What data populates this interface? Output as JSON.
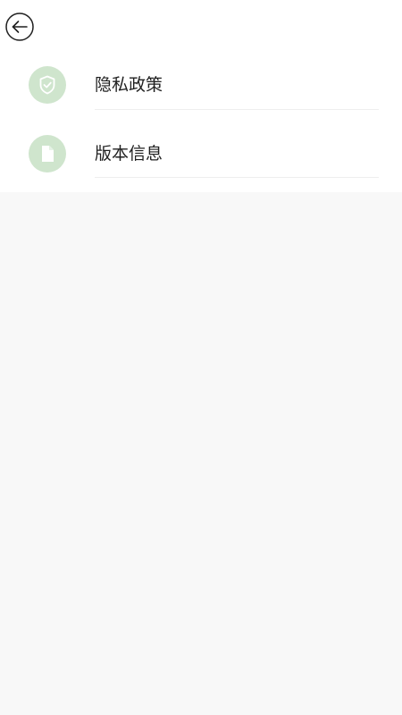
{
  "header": {
    "back_icon": "arrow-left-circle-icon"
  },
  "menu": {
    "items": [
      {
        "label": "隐私政策",
        "icon": "shield-check-icon"
      },
      {
        "label": "版本信息",
        "icon": "document-icon"
      }
    ]
  },
  "colors": {
    "icon_bg": "#cfe5cd",
    "icon_fg": "#ffffff",
    "page_bg": "#f8f8f8",
    "panel_bg": "#ffffff",
    "text": "#1f1f1f",
    "divider": "#eeeeee"
  }
}
